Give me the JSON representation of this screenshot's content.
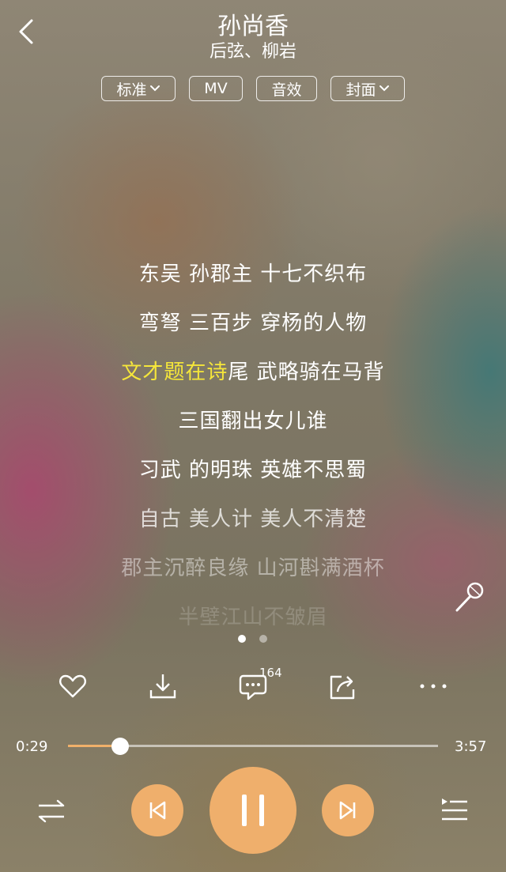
{
  "song": {
    "title": "孙尚香",
    "artist": "后弦、柳岩"
  },
  "options": {
    "quality": "标准",
    "mv": "MV",
    "effect": "音效",
    "cover": "封面"
  },
  "lyrics": [
    {
      "text": "东吴 孙郡主 十七不织布"
    },
    {
      "text": "弯弩 三百步 穿杨的人物"
    },
    {
      "sung": "文才题在诗",
      "rest": "尾 武略骑在马背"
    },
    {
      "text": "三国翻出女儿谁"
    },
    {
      "text": "习武 的明珠 英雄不思蜀"
    },
    {
      "text": "自古 美人计 美人不清楚"
    },
    {
      "text": "郡主沉醉良缘 山河斟满酒杯"
    },
    {
      "text": "半壁江山不皱眉"
    }
  ],
  "comments": {
    "count": "164"
  },
  "progress": {
    "current": "0:29",
    "total": "3:57",
    "fraction": 0.14
  },
  "colors": {
    "accent": "#efaf6c",
    "highlight": "#f5e63a"
  },
  "icons": [
    "back-icon",
    "chevron-down-icon",
    "microphone-icon",
    "heart-icon",
    "download-icon",
    "comment-icon",
    "share-icon",
    "more-icon",
    "shuffle-icon",
    "previous-icon",
    "pause-icon",
    "next-icon",
    "playlist-icon"
  ]
}
